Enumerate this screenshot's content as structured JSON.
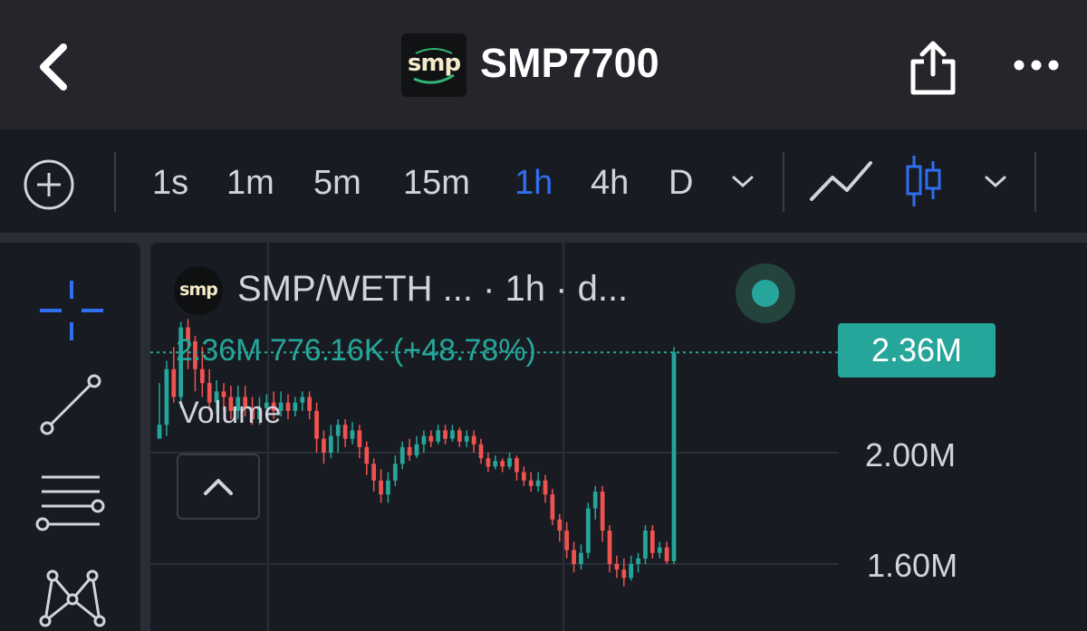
{
  "header": {
    "title": "SMP7700",
    "logo_text": "smp"
  },
  "toolbar": {
    "timeframes": [
      "1s",
      "1m",
      "5m",
      "15m",
      "1h",
      "4h",
      "D"
    ],
    "active_timeframe": "1h"
  },
  "legend": {
    "logo_text": "smp",
    "pair": "SMP/WETH ...",
    "interval": " · 1h · d...",
    "ohlc": "2.36M  776.16K (+48.78%)",
    "volume_label": "Volume"
  },
  "chart_data": {
    "type": "candlestick",
    "price_label": "2.36M",
    "y_tick_labels": [
      "2.00M",
      "1.60M"
    ],
    "y_ticks": [
      2.0,
      1.6
    ],
    "ylim": [
      1.5,
      2.5
    ],
    "last_change": "776.16K",
    "last_change_pct": "+48.78%",
    "colors": {
      "up": "#26a69a",
      "down": "#ef5350"
    },
    "candles": [
      [
        2.05,
        2.1,
        2.25,
        2.08
      ],
      [
        2.1,
        2.3,
        2.33,
        2.06
      ],
      [
        2.3,
        2.2,
        2.38,
        2.18
      ],
      [
        2.2,
        2.45,
        2.47,
        2.16
      ],
      [
        2.45,
        2.4,
        2.48,
        2.3
      ],
      [
        2.4,
        2.3,
        2.42,
        2.22
      ],
      [
        2.3,
        2.25,
        2.38,
        2.2
      ],
      [
        2.25,
        2.18,
        2.3,
        2.15
      ],
      [
        2.18,
        2.22,
        2.26,
        2.14
      ],
      [
        2.22,
        2.2,
        2.25,
        2.15
      ],
      [
        2.2,
        2.15,
        2.24,
        2.12
      ],
      [
        2.15,
        2.2,
        2.24,
        2.12
      ],
      [
        2.2,
        2.16,
        2.24,
        2.13
      ],
      [
        2.16,
        2.12,
        2.2,
        2.1
      ],
      [
        2.12,
        2.16,
        2.2,
        2.1
      ],
      [
        2.16,
        2.18,
        2.21,
        2.14
      ],
      [
        2.18,
        2.15,
        2.22,
        2.12
      ],
      [
        2.15,
        2.18,
        2.22,
        2.13
      ],
      [
        2.18,
        2.15,
        2.21,
        2.12
      ],
      [
        2.15,
        2.18,
        2.2,
        2.13
      ],
      [
        2.18,
        2.2,
        2.22,
        2.15
      ],
      [
        2.2,
        2.15,
        2.22,
        2.12
      ],
      [
        2.15,
        2.05,
        2.18,
        2.0
      ],
      [
        2.05,
        2.0,
        2.08,
        1.96
      ],
      [
        2.0,
        2.06,
        2.1,
        1.98
      ],
      [
        2.06,
        2.1,
        2.12,
        2.0
      ],
      [
        2.1,
        2.05,
        2.12,
        2.02
      ],
      [
        2.05,
        2.08,
        2.11,
        2.03
      ],
      [
        2.08,
        2.02,
        2.1,
        1.98
      ],
      [
        2.02,
        1.96,
        2.04,
        1.92
      ],
      [
        1.96,
        1.9,
        1.98,
        1.86
      ],
      [
        1.9,
        1.85,
        1.94,
        1.82
      ],
      [
        1.85,
        1.9,
        1.93,
        1.82
      ],
      [
        1.9,
        1.96,
        1.99,
        1.88
      ],
      [
        1.96,
        2.02,
        2.04,
        1.94
      ],
      [
        2.02,
        1.99,
        2.05,
        1.97
      ],
      [
        1.99,
        2.03,
        2.06,
        1.98
      ],
      [
        2.03,
        2.06,
        2.08,
        2.0
      ],
      [
        2.06,
        2.04,
        2.08,
        2.02
      ],
      [
        2.04,
        2.08,
        2.1,
        2.03
      ],
      [
        2.08,
        2.05,
        2.1,
        2.03
      ],
      [
        2.05,
        2.08,
        2.1,
        2.04
      ],
      [
        2.08,
        2.04,
        2.09,
        2.02
      ],
      [
        2.04,
        2.06,
        2.08,
        2.02
      ],
      [
        2.06,
        2.03,
        2.08,
        2.0
      ],
      [
        2.03,
        1.98,
        2.05,
        1.96
      ],
      [
        1.98,
        1.95,
        2.0,
        1.93
      ],
      [
        1.95,
        1.97,
        1.99,
        1.94
      ],
      [
        1.97,
        1.95,
        1.98,
        1.93
      ],
      [
        1.95,
        1.98,
        2.0,
        1.94
      ],
      [
        1.98,
        1.93,
        1.99,
        1.9
      ],
      [
        1.93,
        1.9,
        1.95,
        1.88
      ],
      [
        1.9,
        1.88,
        1.93,
        1.86
      ],
      [
        1.88,
        1.9,
        1.93,
        1.86
      ],
      [
        1.9,
        1.85,
        1.92,
        1.82
      ],
      [
        1.85,
        1.76,
        1.87,
        1.74
      ],
      [
        1.76,
        1.72,
        1.78,
        1.68
      ],
      [
        1.72,
        1.65,
        1.75,
        1.62
      ],
      [
        1.65,
        1.6,
        1.68,
        1.57
      ],
      [
        1.6,
        1.64,
        1.67,
        1.58
      ],
      [
        1.64,
        1.8,
        1.82,
        1.62
      ],
      [
        1.8,
        1.86,
        1.88,
        1.76
      ],
      [
        1.86,
        1.72,
        1.88,
        1.68
      ],
      [
        1.72,
        1.6,
        1.74,
        1.57
      ],
      [
        1.6,
        1.58,
        1.63,
        1.55
      ],
      [
        1.58,
        1.55,
        1.62,
        1.52
      ],
      [
        1.55,
        1.6,
        1.63,
        1.54
      ],
      [
        1.6,
        1.62,
        1.64,
        1.57
      ],
      [
        1.62,
        1.72,
        1.74,
        1.6
      ],
      [
        1.72,
        1.64,
        1.74,
        1.62
      ],
      [
        1.64,
        1.66,
        1.68,
        1.62
      ],
      [
        1.66,
        1.61,
        1.68,
        1.6
      ],
      [
        1.61,
        2.36,
        2.38,
        1.6
      ]
    ]
  }
}
